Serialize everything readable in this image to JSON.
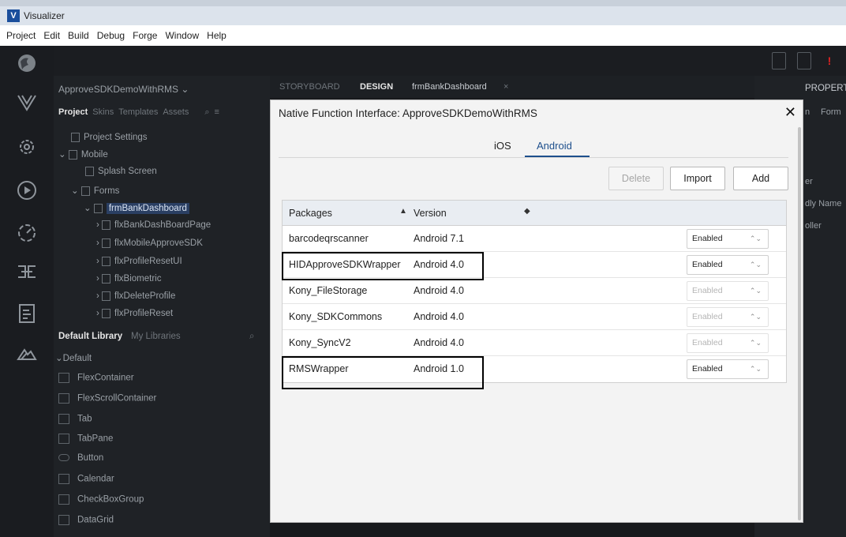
{
  "app": {
    "title": "Visualizer",
    "logo_glyph": "V"
  },
  "menu": [
    "Project",
    "Edit",
    "Build",
    "Debug",
    "Forge",
    "Window",
    "Help"
  ],
  "project_panel": {
    "project_name": "ApproveSDKDemoWithRMS ⌄",
    "tabs": [
      "Project",
      "Skins",
      "Templates",
      "Assets"
    ],
    "tree": [
      {
        "label": "Project Settings"
      },
      {
        "label": "Mobile"
      },
      {
        "label": "Splash Screen"
      },
      {
        "label": "Forms"
      },
      {
        "label": "frmBankDashboard"
      },
      {
        "label": "flxBankDashBoardPage"
      },
      {
        "label": "flxMobileApproveSDK"
      },
      {
        "label": "flxProfileResetUI"
      },
      {
        "label": "flxBiometric"
      },
      {
        "label": "flxDeleteProfile"
      },
      {
        "label": "flxProfileReset"
      }
    ],
    "library_tabs": [
      "Default Library",
      "My Libraries"
    ],
    "library_group": "Default",
    "widgets": [
      "FlexContainer",
      "FlexScrollContainer",
      "Tab",
      "TabPane",
      "Button",
      "Calendar",
      "CheckBoxGroup",
      "DataGrid"
    ]
  },
  "editor_tabs": [
    "STORYBOARD",
    "DESIGN",
    "frmBankDashboard"
  ],
  "editor_tab_close": "×",
  "props_panel": {
    "title": "PROPERT",
    "tabs": [
      "n",
      "Form"
    ],
    "rows": [
      "er",
      "dly Name",
      "oller"
    ]
  },
  "modal": {
    "title": "Native Function Interface: ApproveSDKDemoWithRMS",
    "close": "✕",
    "platform_tabs": [
      "iOS",
      "Android"
    ],
    "active_platform": "Android",
    "buttons": {
      "delete": "Delete",
      "import": "Import",
      "add": "Add"
    },
    "columns": {
      "packages": "Packages",
      "version": "Version"
    },
    "sort_up": "▲",
    "sort_both": "◆",
    "select_arrow": "⌃⌄",
    "rows": [
      {
        "package": "barcodeqrscanner",
        "version": "Android 7.1",
        "status": "Enabled",
        "enabled": true
      },
      {
        "package": "HIDApproveSDKWrapper",
        "version": "Android 4.0",
        "status": "Enabled",
        "enabled": true
      },
      {
        "package": "Kony_FileStorage",
        "version": "Android 4.0",
        "status": "Enabled",
        "enabled": false
      },
      {
        "package": "Kony_SDKCommons",
        "version": "Android 4.0",
        "status": "Enabled",
        "enabled": false
      },
      {
        "package": "Kony_SyncV2",
        "version": "Android 4.0",
        "status": "Enabled",
        "enabled": false
      },
      {
        "package": "RMSWrapper",
        "version": "Android 1.0",
        "status": "Enabled",
        "enabled": true
      }
    ]
  },
  "colors": {
    "accent": "#1d4f8c",
    "dark_bg": "#1f2226",
    "modal_bg": "#f3f3f3"
  }
}
